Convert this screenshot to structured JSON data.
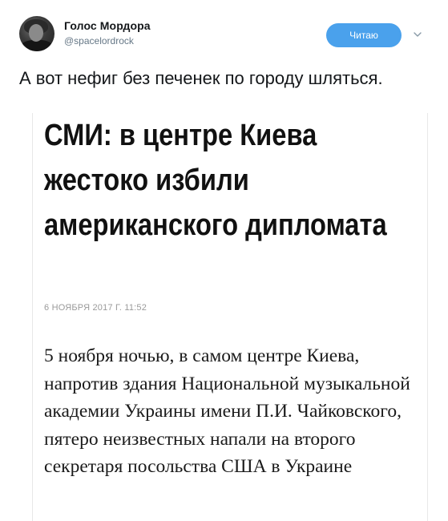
{
  "tweet": {
    "display_name": "Голос Мордора",
    "handle": "@spacelordrock",
    "follow_label": "Читаю",
    "text": "А вот нефиг без печенек по городу шляться.",
    "colors": {
      "follow_button": "#4aa1ec",
      "handle": "#657786"
    }
  },
  "article": {
    "headline": "СМИ: в центре Киева жестоко избили американского дипломата",
    "dateline": "6 НОЯБРЯ 2017 Г. 11:52",
    "body": "5 ноября ночью, в самом центре Киева, напротив здания Национальной музыкальной академии Украины имени П.И. Чайковского, пятеро неизвестных напали на второго секретаря посольства США в Украине"
  }
}
